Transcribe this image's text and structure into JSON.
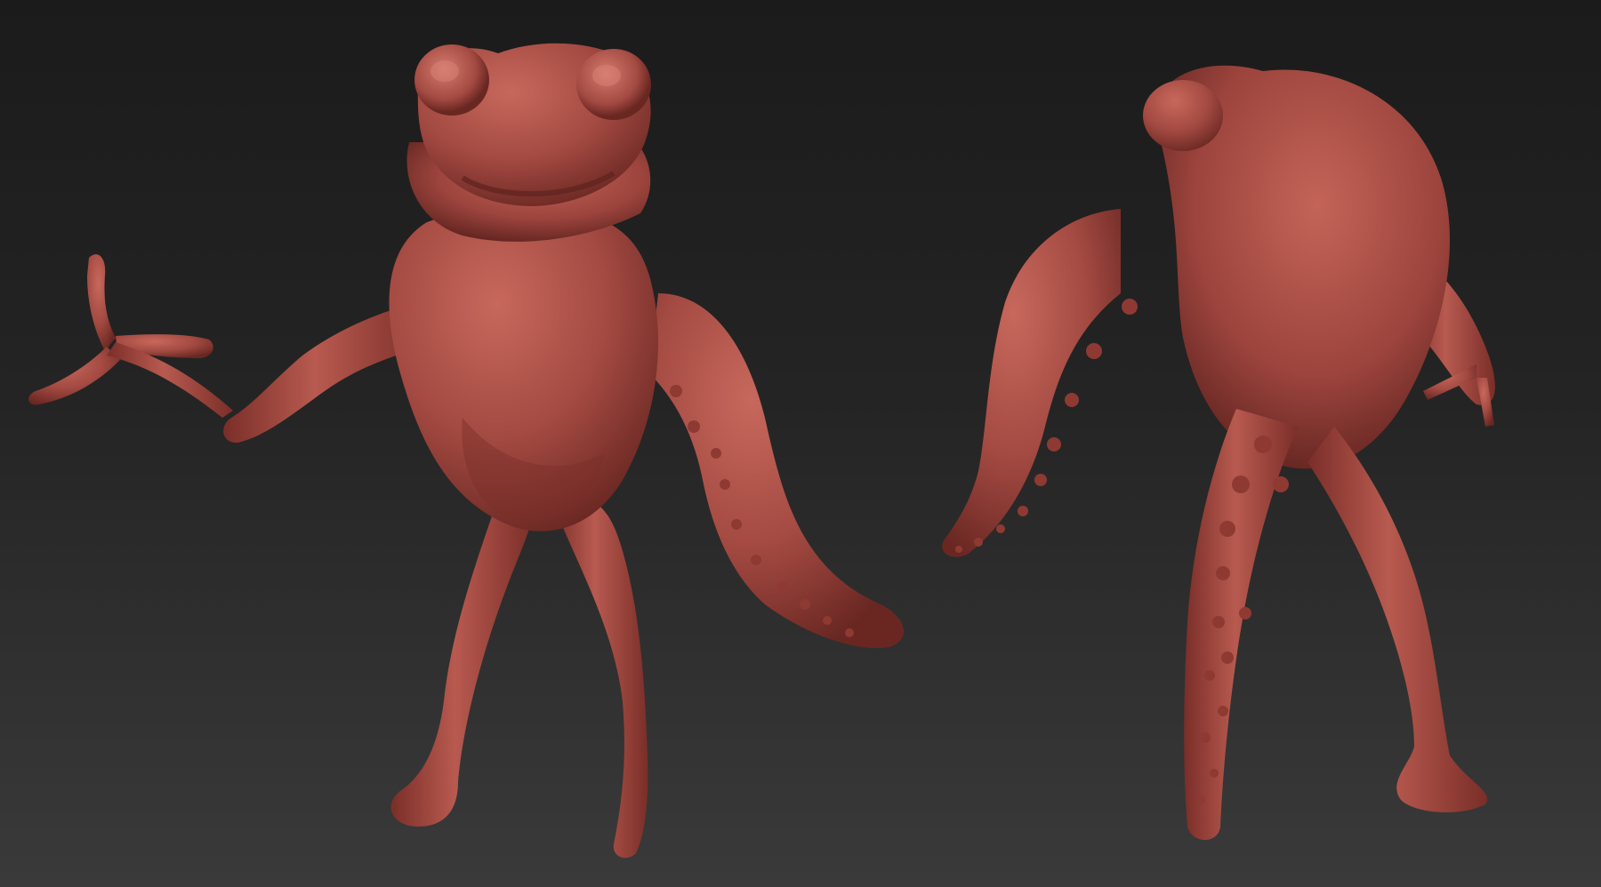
{
  "scene": {
    "background_top": "#1b1b1b",
    "background_bottom": "#3a3a3a",
    "clay_color": "#a34a42",
    "clay_highlight": "#c8685c",
    "clay_shadow": "#5e221e"
  },
  "figures": [
    {
      "view": "front",
      "icon": "creature-front-render"
    },
    {
      "view": "back",
      "icon": "creature-back-render"
    }
  ]
}
